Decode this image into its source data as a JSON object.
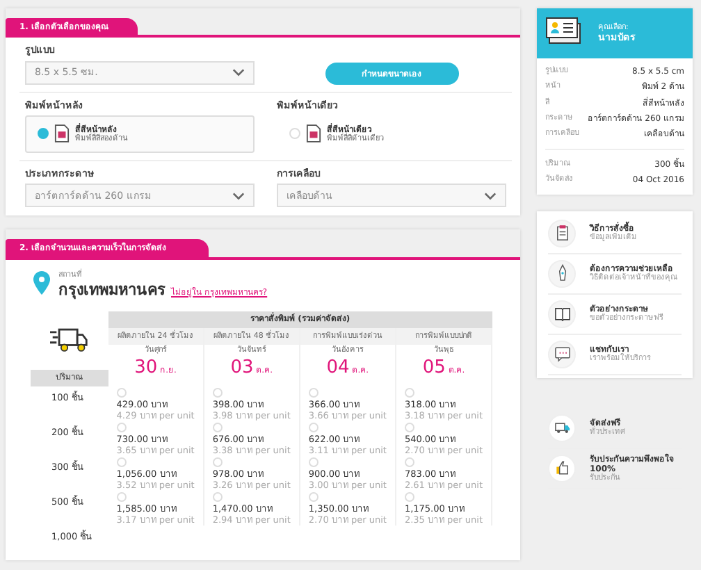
{
  "options_section": {
    "title": "1. เลือกตัวเลือกของคุณ",
    "format": {
      "label": "รูปแบบ",
      "value": "8.5 x 5.5 ซม."
    },
    "custom_size_button": "กำหนดขนาดเอง",
    "sides": [
      {
        "heading": "พิมพ์หน้าหลัง",
        "title": "สี่สีหน้าหลัง",
        "subtitle": "พิมพ์สี่สีสองด้าน",
        "selected": true
      },
      {
        "heading": "พิมพ์หน้าเดียว",
        "title": "สี่สีหน้าเดียว",
        "subtitle": "พิมพ์สี่สีด้านเดียว",
        "selected": false
      }
    ],
    "paper": {
      "label": "ประเภทกระดาษ",
      "value": "อาร์ตการ์ดด้าน 260 แกรม"
    },
    "coating": {
      "label": "การเคลือบ",
      "value": "เคลือบด้าน"
    }
  },
  "delivery_section": {
    "title": "2. เลือกจำนวนและความเร็วในการจัดส่ง",
    "location_label": "สถานที่",
    "location": "กรุงเทพมหานคร",
    "location_link": "ไม่อยู่ใน กรุงเทพมหานคร?",
    "price_header": "ราคาสั่งพิมพ์ (รวมค่าจัดส่ง)",
    "quantity_header": "ปริมาณ",
    "columns": [
      {
        "name": "ผลิตภายใน 24 ชั่วโมง",
        "weekday": "วันศุกร์",
        "day": "30",
        "month": "ก.ย."
      },
      {
        "name": "ผลิตภายใน 48 ชั่วโมง",
        "weekday": "วันจันทร์",
        "day": "03",
        "month": "ต.ค."
      },
      {
        "name": "การพิมพ์แบบเร่งด่วน",
        "weekday": "วันอังคาร",
        "day": "04",
        "month": "ต.ค."
      },
      {
        "name": "การพิมพ์แบบปกติ",
        "weekday": "วันพุธ",
        "day": "05",
        "month": "ต.ค."
      }
    ],
    "rows": [
      {
        "quantity": "100 ชิ้น",
        "prices": [
          {
            "price": "429.00 บาท",
            "unit": "4.29 บาท per unit",
            "selected": false
          },
          {
            "price": "398.00 บาท",
            "unit": "3.98 บาท per unit",
            "selected": false
          },
          {
            "price": "366.00 บาท",
            "unit": "3.66 บาท per unit",
            "selected": false
          },
          {
            "price": "318.00 บาท",
            "unit": "3.18 บาท per unit",
            "selected": false
          }
        ]
      },
      {
        "quantity": "200 ชิ้น",
        "prices": [
          {
            "price": "730.00 บาท",
            "unit": "3.65 บาท per unit",
            "selected": false
          },
          {
            "price": "676.00 บาท",
            "unit": "3.38 บาท per unit",
            "selected": false
          },
          {
            "price": "622.00 บาท",
            "unit": "3.11 บาท per unit",
            "selected": false
          },
          {
            "price": "540.00 บาท",
            "unit": "2.70 บาท per unit",
            "selected": false
          }
        ]
      },
      {
        "quantity": "300 ชิ้น",
        "prices": [
          {
            "price": "1,056.00 บาท",
            "unit": "3.52 บาท per unit",
            "selected": false
          },
          {
            "price": "978.00 บาท",
            "unit": "3.26 บาท per unit",
            "selected": false
          },
          {
            "price": "900.00 บาท",
            "unit": "3.00 บาท per unit",
            "selected": false
          },
          {
            "price": "783.00 บาท",
            "unit": "2.61 บาท per unit",
            "selected": false
          }
        ]
      },
      {
        "quantity": "500 ชิ้น",
        "prices": [
          {
            "price": "1,585.00 บาท",
            "unit": "3.17 บาท per unit",
            "selected": false
          },
          {
            "price": "1,470.00 บาท",
            "unit": "2.94 บาท per unit",
            "selected": false
          },
          {
            "price": "1,350.00 บาท",
            "unit": "2.70 บาท per unit",
            "selected": false
          },
          {
            "price": "1,175.00 บาท",
            "unit": "2.35 บาท per unit",
            "selected": false
          }
        ]
      },
      {
        "quantity": "1,000 ชิ้น"
      }
    ]
  },
  "summary": {
    "heading": "คุณเลือก:",
    "product": "นามบัตร",
    "details": [
      {
        "label": "รูปแบบ",
        "value": "8.5 x 5.5 cm"
      },
      {
        "label": "หน้า",
        "value": "พิมพ์ 2 ด้าน"
      },
      {
        "label": "สี",
        "value": "สี่สีหน้าหลัง"
      },
      {
        "label": "กระดาษ",
        "value": "อาร์ตการ์ดด้าน 260 แกรม"
      },
      {
        "label": "การเคลือบ",
        "value": "เคลือบด้าน"
      }
    ],
    "totals": [
      {
        "label": "ปริมาณ",
        "value": "300 ชิ้น"
      },
      {
        "label": "วันจัดส่ง",
        "value": "04 Oct 2016"
      }
    ]
  },
  "help_links": [
    {
      "kind": "clipboard",
      "title": "วิธีการสั่งซื้อ",
      "subtitle": "ข้อมูลเพิ่มเติม"
    },
    {
      "kind": "pen",
      "title": "ต้องการความช่วยเหลือ",
      "subtitle": "วิธีติดต่อเจ้าหน้าที่ของคุณ"
    },
    {
      "kind": "book",
      "title": "ตัวอย่างกระดาษ",
      "subtitle": "ขอตัวอย่างกระดาษฟรี"
    },
    {
      "kind": "chat",
      "title": "แชทกับเรา",
      "subtitle": "เราพร้อมให้บริการ"
    }
  ],
  "benefits": [
    {
      "kind": "truck",
      "title": "จัดส่งฟรี",
      "subtitle": "ทั่วประเทศ"
    },
    {
      "kind": "thumb",
      "title": "รับประกันความพึงพอใจ 100%",
      "subtitle": "รับประกัน"
    }
  ]
}
